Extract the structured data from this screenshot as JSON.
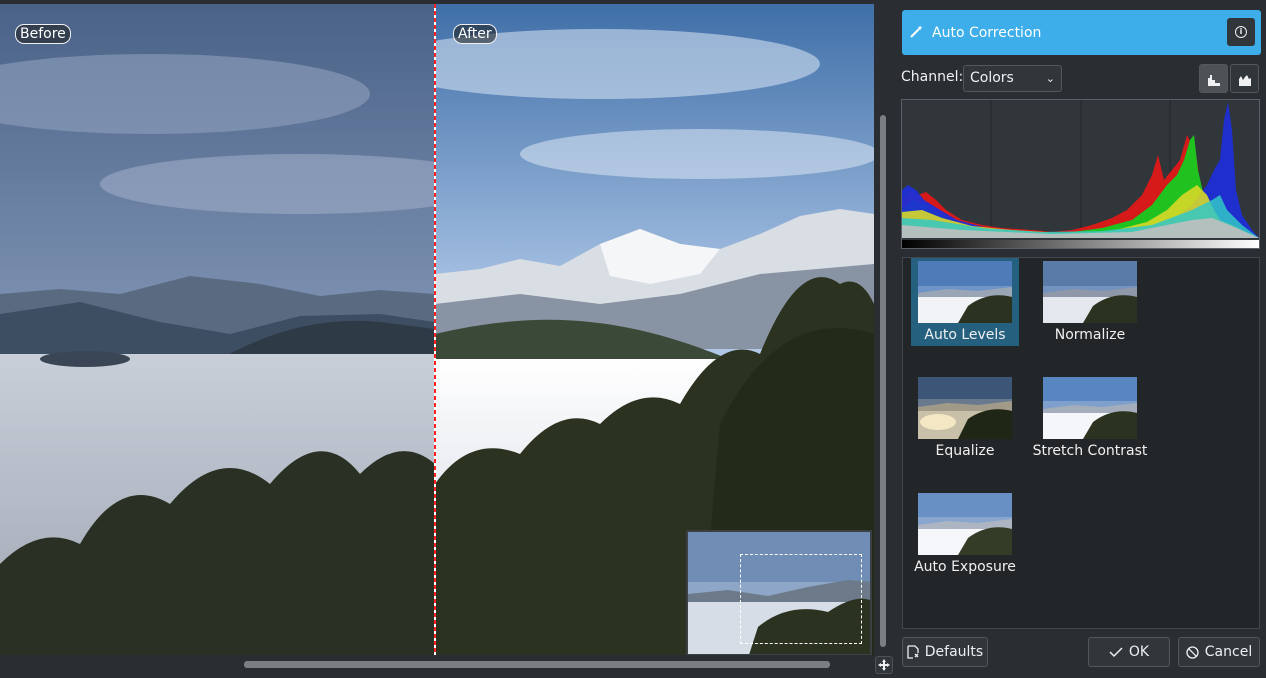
{
  "preview": {
    "before_label": "Before",
    "after_label": "After"
  },
  "panel": {
    "title": "Auto Correction",
    "title_icon": "magic-wand-icon",
    "info_icon": "info-icon",
    "channel_label": "Channel:",
    "channel_value": "Colors",
    "histogram_linear_icon": "linear-histogram-icon",
    "histogram_log_icon": "logarithmic-histogram-icon"
  },
  "presets": [
    {
      "name": "Auto Levels",
      "selected": true
    },
    {
      "name": "Normalize",
      "selected": false
    },
    {
      "name": "Equalize",
      "selected": false
    },
    {
      "name": "Stretch Contrast",
      "selected": false
    },
    {
      "name": "Auto Exposure",
      "selected": false
    }
  ],
  "buttons": {
    "defaults": "Defaults",
    "ok": "OK",
    "cancel": "Cancel"
  },
  "colors": {
    "accent": "#3daee9",
    "selection": "#25607f",
    "background": "#2a2e32",
    "split_line": "#ff2020"
  }
}
